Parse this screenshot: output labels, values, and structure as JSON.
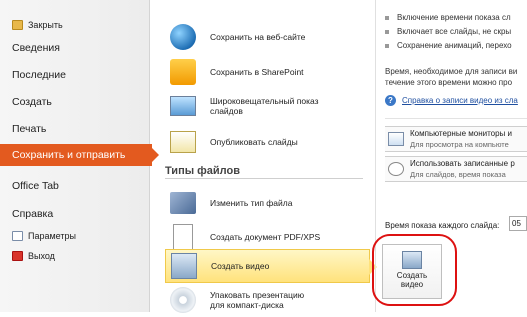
{
  "nav": {
    "close": "Закрыть",
    "items": [
      "Сведения",
      "Последние",
      "Создать",
      "Печать",
      "Сохранить и отправить",
      "Office Tab",
      "Справка"
    ],
    "options": "Параметры",
    "exit": "Выход"
  },
  "middle": {
    "items": [
      {
        "label": "Сохранить на веб-сайте"
      },
      {
        "label": "Сохранить в SharePoint"
      },
      {
        "label": "Широковещательный показ слайдов"
      },
      {
        "label": "Опубликовать слайды"
      }
    ],
    "section_title": "Типы файлов",
    "file_types": [
      {
        "label": "Изменить тип файла"
      },
      {
        "label": "Создать документ PDF/XPS"
      },
      {
        "label": "Создать видео"
      },
      {
        "label": "Упаковать презентацию для компакт-диска"
      }
    ]
  },
  "right": {
    "bullets": [
      "Включение времени показа сл",
      "Включает все слайды, не скры",
      "Сохранение анимаций, перехо"
    ],
    "para1": "Время, необходимое для записи ви",
    "para2": "течение этого времени можно про",
    "help_link": "Справка о записи видео из сла",
    "dropdown1": {
      "title": "Компьютерные мониторы и",
      "subtitle": "Для просмотра на компьюте"
    },
    "dropdown2": {
      "title": "Использовать записанные р",
      "subtitle": "Для слайдов, время показа"
    },
    "duration_label": "Время показа каждого слайда:",
    "duration_value": "05",
    "create_button": "Создать видео"
  }
}
